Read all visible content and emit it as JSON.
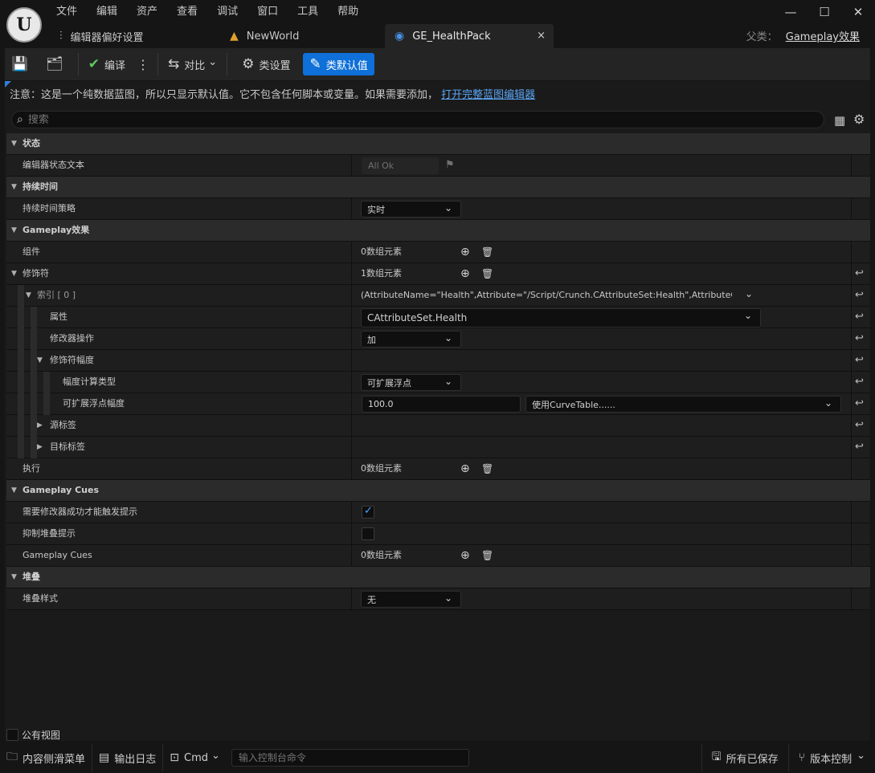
{
  "menu": [
    "文件",
    "编辑",
    "资产",
    "查看",
    "调试",
    "窗口",
    "工具",
    "帮助"
  ],
  "logo_text": "U",
  "window_controls": {
    "minimize": "—",
    "maximize": "☐",
    "close": "✕"
  },
  "tabs": [
    {
      "label": "编辑器偏好设置",
      "icon": "⫶"
    },
    {
      "label": "NewWorld",
      "icon": "▲"
    },
    {
      "label": "GE_HealthPack",
      "icon": "◉"
    }
  ],
  "tab_close": "×",
  "parent_class": {
    "label": "父类：",
    "value": "Gameplay效果"
  },
  "toolbar": {
    "save_icon": "💾",
    "browse_icon": "🗂",
    "compile_icon": "✔",
    "compile_label": "编译",
    "more": "⋮",
    "diff_icon": "⇆",
    "diff_label": "对比",
    "diff_chev": "⌄",
    "settings_icon": "⚙",
    "settings_label": "类设置",
    "defaults_icon": "✎",
    "defaults_label": "类默认值"
  },
  "notice": {
    "text": "注意：这是一个纯数据蓝图，所以只显示默认值。它不包含任何脚本或变量。如果需要添加，",
    "link": "打开完整蓝图编辑器"
  },
  "search": {
    "placeholder": "搜索",
    "icon": "⌕"
  },
  "grid_icons": {
    "table": "▦",
    "gear": "⚙"
  },
  "rows": {
    "cat_status": "状态",
    "editor_status_text": "编辑器状态文本",
    "status_value": "All Ok",
    "cat_duration": "持续时间",
    "duration_policy": "持续时间策略",
    "duration_policy_value": "实时",
    "cat_gameplay_effect": "Gameplay效果",
    "components": "组件",
    "components_value": "0数组元素",
    "modifiers": "修饰符",
    "modifiers_value": "1数组元素",
    "index0": "索引 [ 0 ]",
    "index0_value": "(AttributeName=\"Health\",Attribute=\"/Script/Crunch.CAttributeSet:Health\",AttributeOwner=\"/",
    "attribute": "属性",
    "attribute_value": "CAttributeSet.Health",
    "modifier_op": "修改器操作",
    "modifier_op_value": "加",
    "modifier_magnitude": "修饰符幅度",
    "magnitude_calc_type": "幅度计算类型",
    "magnitude_calc_type_value": "可扩展浮点",
    "scalable_float_magnitude": "可扩展浮点幅度",
    "scalable_float_value": "100.0",
    "curve_table_value": "使用CurveTable......",
    "source_tags": "源标签",
    "target_tags": "目标标签",
    "executions": "执行",
    "executions_value": "0数组元素",
    "cat_gameplay_cues": "Gameplay Cues",
    "require_modifier_success": "需要修改器成功才能触发提示",
    "require_modifier_success_checked": true,
    "suppress_stacking_cues": "抑制堆叠提示",
    "suppress_stacking_cues_checked": false,
    "gameplay_cues": "Gameplay Cues",
    "gameplay_cues_value": "0数组元素",
    "cat_stacking": "堆叠",
    "stacking_type": "堆叠样式",
    "stacking_type_value": "无"
  },
  "symbols": {
    "expanded": "▼",
    "collapsed": "▶",
    "chev": "⌄",
    "add": "⊕",
    "trash": "🗑",
    "reset": "↩",
    "flag": "⚑"
  },
  "public_view": "公有视图",
  "statusbar": {
    "content_drawer": "内容侧滑菜单",
    "content_drawer_icon": "🗀",
    "output_log": "输出日志",
    "output_log_icon": "▤",
    "cmd": "Cmd",
    "cmd_icon": "⊡",
    "cmd_placeholder": "输入控制台命令",
    "all_saved": "所有已保存",
    "all_saved_icon": "🖫",
    "source_control": "版本控制",
    "source_control_icon": "⑂"
  },
  "colors": {
    "accent": "#0e70d8",
    "link": "#5aa5f5",
    "check": "#4aa8ff"
  }
}
